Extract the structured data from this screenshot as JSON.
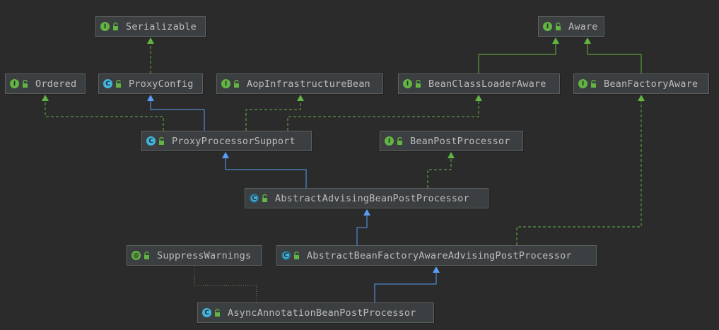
{
  "diagram": {
    "nodes": [
      {
        "id": "serializable",
        "label": "Serializable",
        "kind": "interface",
        "kind_letter": "I"
      },
      {
        "id": "aware",
        "label": "Aware",
        "kind": "interface",
        "kind_letter": "I"
      },
      {
        "id": "ordered",
        "label": "Ordered",
        "kind": "interface",
        "kind_letter": "I"
      },
      {
        "id": "proxyconfig",
        "label": "ProxyConfig",
        "kind": "class",
        "kind_letter": "C"
      },
      {
        "id": "aopinfra",
        "label": "AopInfrastructureBean",
        "kind": "interface",
        "kind_letter": "I"
      },
      {
        "id": "beanclassloaderaware",
        "label": "BeanClassLoaderAware",
        "kind": "interface",
        "kind_letter": "I"
      },
      {
        "id": "beanfactoryaware",
        "label": "BeanFactoryAware",
        "kind": "interface",
        "kind_letter": "I"
      },
      {
        "id": "proxyprocessorsupport",
        "label": "ProxyProcessorSupport",
        "kind": "class",
        "kind_letter": "C"
      },
      {
        "id": "beanpostprocessor",
        "label": "BeanPostProcessor",
        "kind": "interface",
        "kind_letter": "I"
      },
      {
        "id": "abstractadvising",
        "label": "AbstractAdvisingBeanPostProcessor",
        "kind": "abstract",
        "kind_letter": "C"
      },
      {
        "id": "suppresswarnings",
        "label": "SuppressWarnings",
        "kind": "annotation",
        "kind_letter": "@"
      },
      {
        "id": "abstractbeanfactoryaware",
        "label": "AbstractBeanFactoryAwareAdvisingPostProcessor",
        "kind": "abstract",
        "kind_letter": "C"
      },
      {
        "id": "asyncannotation",
        "label": "AsyncAnnotationBeanPostProcessor",
        "kind": "class",
        "kind_letter": "C"
      }
    ],
    "edges": [
      {
        "from": "proxyconfig",
        "to": "serializable",
        "relation": "implements"
      },
      {
        "from": "beanclassloaderaware",
        "to": "aware",
        "relation": "extends"
      },
      {
        "from": "beanfactoryaware",
        "to": "aware",
        "relation": "extends"
      },
      {
        "from": "proxyprocessorsupport",
        "to": "ordered",
        "relation": "implements"
      },
      {
        "from": "proxyprocessorsupport",
        "to": "proxyconfig",
        "relation": "extends"
      },
      {
        "from": "proxyprocessorsupport",
        "to": "aopinfra",
        "relation": "implements"
      },
      {
        "from": "proxyprocessorsupport",
        "to": "beanclassloaderaware",
        "relation": "implements"
      },
      {
        "from": "abstractadvising",
        "to": "proxyprocessorsupport",
        "relation": "extends"
      },
      {
        "from": "abstractadvising",
        "to": "beanpostprocessor",
        "relation": "implements"
      },
      {
        "from": "abstractbeanfactoryaware",
        "to": "abstractadvising",
        "relation": "extends"
      },
      {
        "from": "abstractbeanfactoryaware",
        "to": "beanfactoryaware",
        "relation": "implements"
      },
      {
        "from": "asyncannotation",
        "to": "abstractbeanfactoryaware",
        "relation": "extends"
      },
      {
        "from": "asyncannotation",
        "to": "suppresswarnings",
        "relation": "annotated"
      }
    ],
    "colors": {
      "background": "#2b2b2b",
      "node_fill": "#3c3f41",
      "node_border": "#5e6060",
      "text": "#bbbbbb",
      "extends_class_edge": "#589df6",
      "interface_edge": "#62b543",
      "annotation_edge": "#8a8a5a",
      "interface_badge": "#62b543",
      "class_badge": "#40b6e0"
    }
  }
}
